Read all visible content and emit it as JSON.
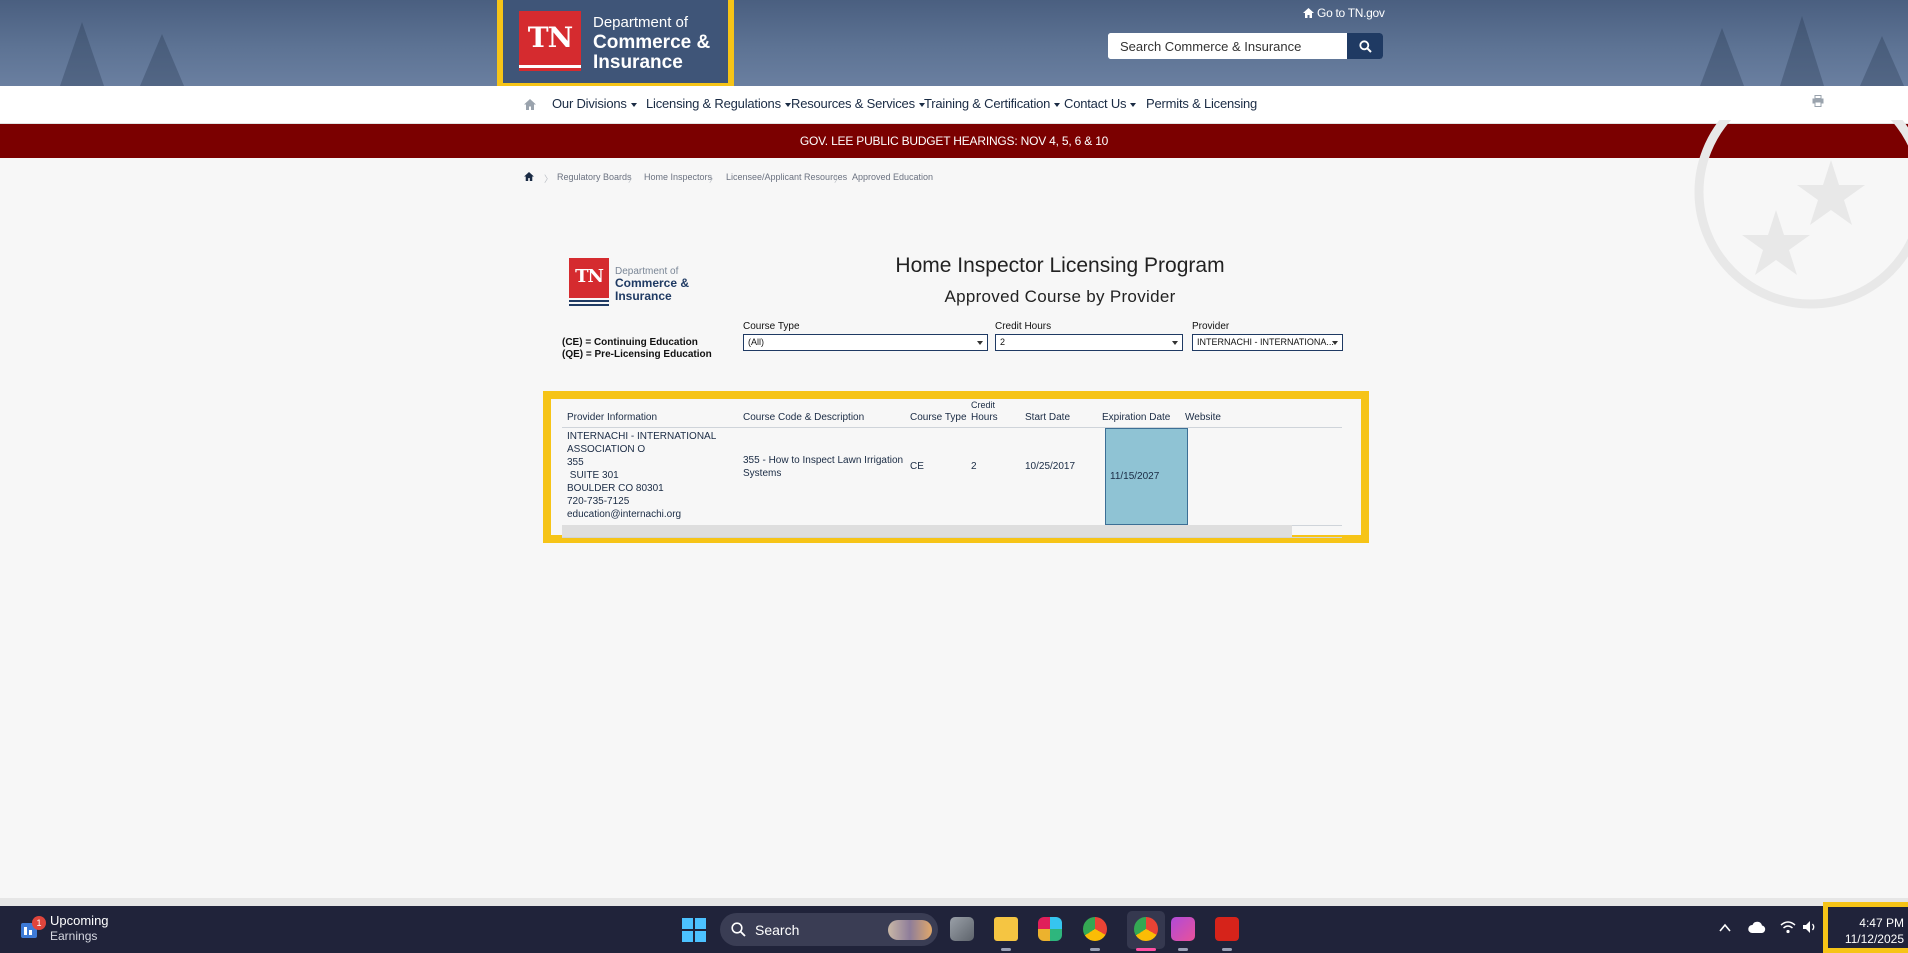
{
  "header": {
    "logo": {
      "badge": "TN",
      "line1": "Department of",
      "line2": "Commerce &",
      "line3": "Insurance"
    },
    "goto_link": "Go to TN.gov",
    "search": {
      "placeholder": "Search Commerce & Insurance"
    }
  },
  "nav": {
    "items": [
      {
        "label": "Our Divisions",
        "dropdown": true
      },
      {
        "label": "Licensing & Regulations",
        "dropdown": true
      },
      {
        "label": "Resources & Services",
        "dropdown": true
      },
      {
        "label": "Training & Certification",
        "dropdown": true
      },
      {
        "label": "Contact Us",
        "dropdown": true
      },
      {
        "label": "Permits & Licensing",
        "dropdown": false
      }
    ]
  },
  "alert": {
    "text": "GOV. LEE PUBLIC BUDGET HEARINGS: NOV 4, 5, 6 & 10"
  },
  "breadcrumb": [
    "Regulatory Boards",
    "Home Inspectors",
    "Licensee/Applicant Resources",
    "Approved Education"
  ],
  "report": {
    "logo": {
      "badge": "TN",
      "line1": "Department of",
      "line2": "Commerce &",
      "line3": "Insurance"
    },
    "title": "Home Inspector Licensing Program",
    "subtitle": "Approved Course by Provider",
    "legend": [
      "(CE) = Continuing Education",
      "(QE) = Pre-Licensing Education"
    ],
    "filters": {
      "course_type": {
        "label": "Course Type",
        "value": "(All)"
      },
      "credit_hours": {
        "label": "Credit Hours",
        "value": "2"
      },
      "provider": {
        "label": "Provider",
        "value": "INTERNACHI - INTERNATIONA..."
      }
    },
    "table": {
      "columns": [
        "Provider Information",
        "Course Code & Description",
        "Course Type",
        "Credit",
        "Hours",
        "Start Date",
        "Expiration Date",
        "Website"
      ],
      "row": {
        "provider_lines": [
          "INTERNACHI - INTERNATIONAL",
          "ASSOCIATION O",
          "355",
          " SUITE 301",
          "BOULDER CO 80301",
          "720-735-7125",
          "education@internachi.org"
        ],
        "course_line1": "355 - How to Inspect Lawn Irrigation",
        "course_line2": "Systems",
        "course_type": "CE",
        "credit_hours": "2",
        "start_date": "10/25/2017",
        "expiration_date": "11/15/2027",
        "website": ""
      }
    }
  },
  "taskbar": {
    "widget": {
      "badge": "1",
      "line1": "Upcoming",
      "line2": "Earnings"
    },
    "search_label": "Search",
    "clock": {
      "time": "4:47 PM",
      "date": "11/12/2025"
    }
  },
  "colors": {
    "navy": "#1f3a63",
    "tn_red": "#d52b2f",
    "alert_red": "#7b0000",
    "highlight": "#f6c417",
    "selected_cell": "#8fc3d4"
  }
}
